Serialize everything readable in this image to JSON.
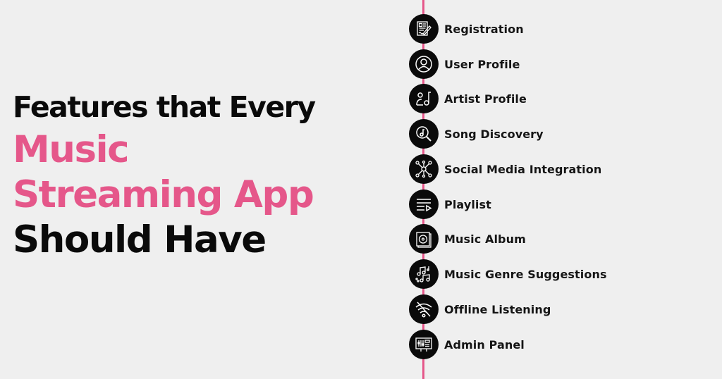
{
  "headline": {
    "line1": "Features that Every",
    "line2": "Music",
    "line3": "Streaming App",
    "line4": "Should Have"
  },
  "colors": {
    "accent": "#e5578a",
    "text": "#0a0a0a",
    "background": "#efefef",
    "icon_circle": "#0a0a0a"
  },
  "features": [
    {
      "label": "Registration",
      "icon": "registration-form-icon"
    },
    {
      "label": "User Profile",
      "icon": "user-profile-icon"
    },
    {
      "label": "Artist Profile",
      "icon": "artist-music-note-icon"
    },
    {
      "label": "Song Discovery",
      "icon": "music-search-icon"
    },
    {
      "label": "Social Media Integration",
      "icon": "network-hub-icon"
    },
    {
      "label": "Playlist",
      "icon": "playlist-icon"
    },
    {
      "label": "Music Album",
      "icon": "album-disc-icon"
    },
    {
      "label": "Music Genre Suggestions",
      "icon": "music-notes-icon"
    },
    {
      "label": "Offline Listening",
      "icon": "wifi-off-icon"
    },
    {
      "label": "Admin Panel",
      "icon": "admin-panel-icon"
    }
  ]
}
